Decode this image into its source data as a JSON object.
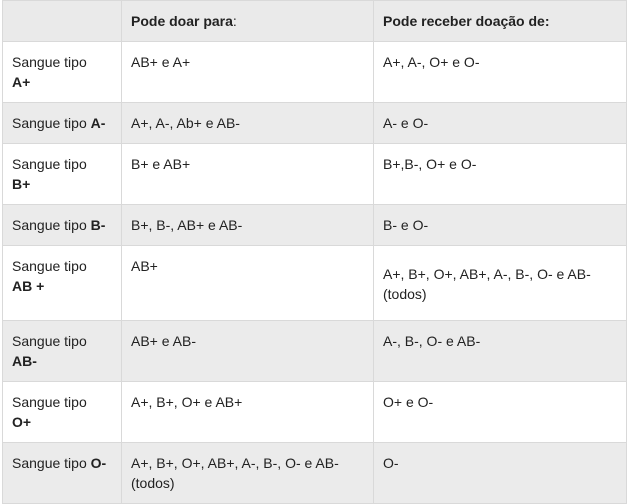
{
  "headers": {
    "col1": "",
    "col2_bold": "Pode doar para",
    "col2_rest": ":",
    "col3": "Pode receber doação de:"
  },
  "rows": [
    {
      "prefix": "Sangue tipo",
      "type": "A+",
      "donate": "AB+ e A+",
      "receive": "A+, A-, O+ e O-"
    },
    {
      "prefix": "Sangue tipo",
      "type": "A-",
      "donate": "A+, A-, Ab+ e AB-",
      "receive": "A- e O-"
    },
    {
      "prefix": "Sangue tipo",
      "type": "B+",
      "donate": "B+ e AB+",
      "receive": "B+,B-, O+ e O-"
    },
    {
      "prefix": "Sangue tipo",
      "type": "B-",
      "donate": "B+, B-, AB+ e AB-",
      "receive": "B- e O-"
    },
    {
      "prefix": "Sangue tipo",
      "type": "AB +",
      "donate": "AB+",
      "receive": "A+, B+, O+, AB+, A-, B-, O- e AB- (todos)"
    },
    {
      "prefix": "Sangue tipo",
      "type": "AB-",
      "donate": "AB+ e AB-",
      "receive": "A-, B-, O- e AB-"
    },
    {
      "prefix": "Sangue tipo",
      "type": "O+",
      "donate": "A+, B+, O+ e AB+",
      "receive": "O+ e O-"
    },
    {
      "prefix": "Sangue tipo",
      "type": "O-",
      "donate": "A+, B+, O+, AB+, A-, B-, O- e AB- (todos)",
      "receive": "O-"
    }
  ]
}
